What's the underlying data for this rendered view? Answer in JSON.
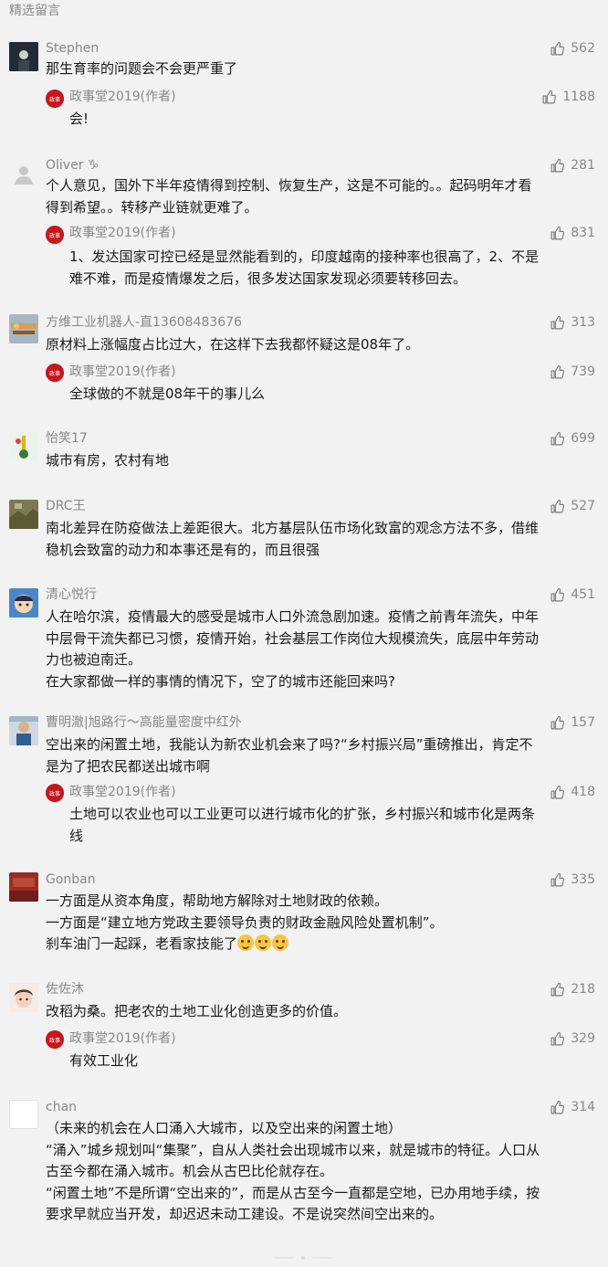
{
  "section_title": "精选留言",
  "author_name": "政事堂2019(作者)",
  "comments": [
    {
      "name": "Stephen",
      "likes": "562",
      "lines": [
        "那生育率的问题会不会更严重了"
      ],
      "reply": {
        "likes": "1188",
        "lines": [
          "会!"
        ]
      }
    },
    {
      "name": "Oliver ♑",
      "likes": "281",
      "lines": [
        "个人意见，国外下半年疫情得到控制、恢复生产，这是不可能的。。起码明年才看",
        "得到希望。。转移产业链就更难了。"
      ],
      "reply": {
        "likes": "831",
        "lines": [
          "1、发达国家可控已经是显然能看到的，印度越南的接种率也很高了，2、不是",
          "难不难，而是疫情爆发之后，很多发达国家发现必须要转移回去。"
        ]
      }
    },
    {
      "name": "方维工业机器人-直13608483676",
      "likes": "313",
      "lines": [
        "原材料上涨幅度占比过大，在这样下去我都怀疑这是08年了。"
      ],
      "reply": {
        "likes": "739",
        "lines": [
          "全球做的不就是08年干的事儿么"
        ]
      }
    },
    {
      "name": "怡笑17",
      "likes": "699",
      "lines": [
        "城市有房，农村有地"
      ]
    },
    {
      "name": "DRC王",
      "likes": "527",
      "lines": [
        "南北差异在防疫做法上差距很大。北方基层队伍市场化致富的观念方法不多，借维",
        "稳机会致富的动力和本事还是有的，而且很强"
      ]
    },
    {
      "name": "清心悦行",
      "likes": "451",
      "lines": [
        "人在哈尔滨，疫情最大的感受是城市人口外流急剧加速。疫情之前青年流失，中年",
        "中层骨干流失都已习惯，疫情开始，社会基层工作岗位大规模流失，底层中年劳动",
        "力也被迫南迁。",
        "在大家都做一样的事情的情况下，空了的城市还能回来吗?"
      ]
    },
    {
      "name": "曹明澈|旭路行～高能量密度中红外",
      "likes": "157",
      "lines": [
        "空出来的闲置土地，我能认为新农业机会来了吗?“乡村振兴局”重磅推出，肯定不",
        "是为了把农民都送出城市啊"
      ],
      "reply": {
        "likes": "418",
        "lines": [
          "土地可以农业也可以工业更可以进行城市化的扩张，乡村振兴和城市化是两条",
          "线"
        ]
      }
    },
    {
      "name": "Gonban",
      "likes": "335",
      "lines": [
        "一方面是从资本角度，帮助地方解除对土地财政的依赖。",
        "一方面是“建立地方党政主要领导负责的财政金融风险处置机制”。",
        "刹车油门一起踩，老看家技能了"
      ]
    },
    {
      "name": "佐佐沐",
      "likes": "218",
      "lines": [
        "改稻为桑。把老农的土地工业化创造更多的价值。"
      ],
      "reply": {
        "likes": "329",
        "lines": [
          "有效工业化"
        ]
      }
    },
    {
      "name": "chan",
      "likes": "314",
      "lines": [
        "（未来的机会在人口涌入大城市，以及空出来的闲置土地）",
        "“涌入”城乡规划叫“集聚”，自从人类社会出现城市以来，就是城市的特征。人口从",
        "古至今都在涌入城市。机会从古巴比伦就存在。",
        "“闲置土地”不是所谓“空出来的”，而是从古至今一直都是空地，已办用地手续，按",
        "要求早就应当开发，却迟迟未动工建设。不是说突然间空出来的。"
      ]
    }
  ]
}
